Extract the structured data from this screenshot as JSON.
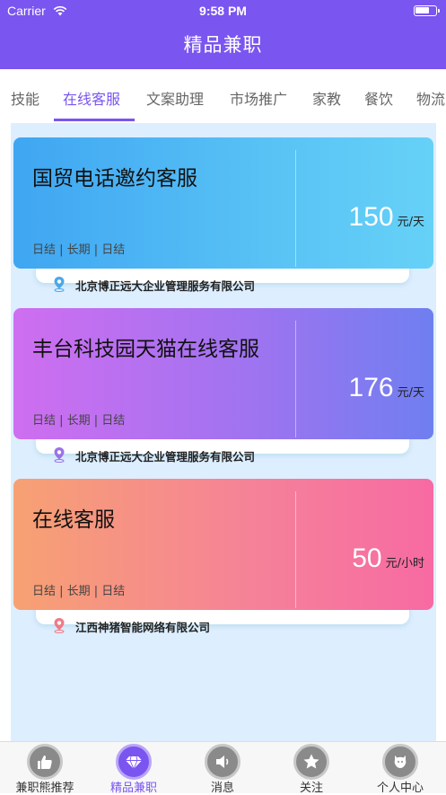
{
  "status_bar": {
    "carrier": "Carrier",
    "time": "9:58 PM"
  },
  "header": {
    "title": "精品兼职"
  },
  "tabs": [
    {
      "label": "技能"
    },
    {
      "label": "在线客服",
      "active": true
    },
    {
      "label": "文案助理"
    },
    {
      "label": "市场推广"
    },
    {
      "label": "家教"
    },
    {
      "label": "餐饮"
    },
    {
      "label": "物流"
    }
  ],
  "jobs": [
    {
      "title": "国贸电话邀约客服",
      "tags": "日结 | 长期 | 日结",
      "salary": "150",
      "unit": "元/天",
      "company": "北京博正远大企业管理服务有限公司",
      "pin_color": "#4aa8e8"
    },
    {
      "title": "丰台科技园天猫在线客服",
      "tags": "日结 | 长期 | 日结",
      "salary": "176",
      "unit": "元/天",
      "company": "北京博正远大企业管理服务有限公司",
      "pin_color": "#9a72e8"
    },
    {
      "title": "在线客服",
      "tags": "日结 | 长期 | 日结",
      "salary": "50",
      "unit": "元/小时",
      "company": "江西神猪智能网络有限公司",
      "pin_color": "#f07a84"
    }
  ],
  "tabbar": [
    {
      "label": "兼职熊推荐",
      "icon": "thumbs-up-icon"
    },
    {
      "label": "精品兼职",
      "icon": "diamond-icon",
      "active": true
    },
    {
      "label": "消息",
      "icon": "speaker-icon"
    },
    {
      "label": "关注",
      "icon": "star-icon"
    },
    {
      "label": "个人中心",
      "icon": "person-icon"
    }
  ],
  "colors": {
    "accent": "#7a55f0",
    "list_background": "#ddeeff"
  }
}
